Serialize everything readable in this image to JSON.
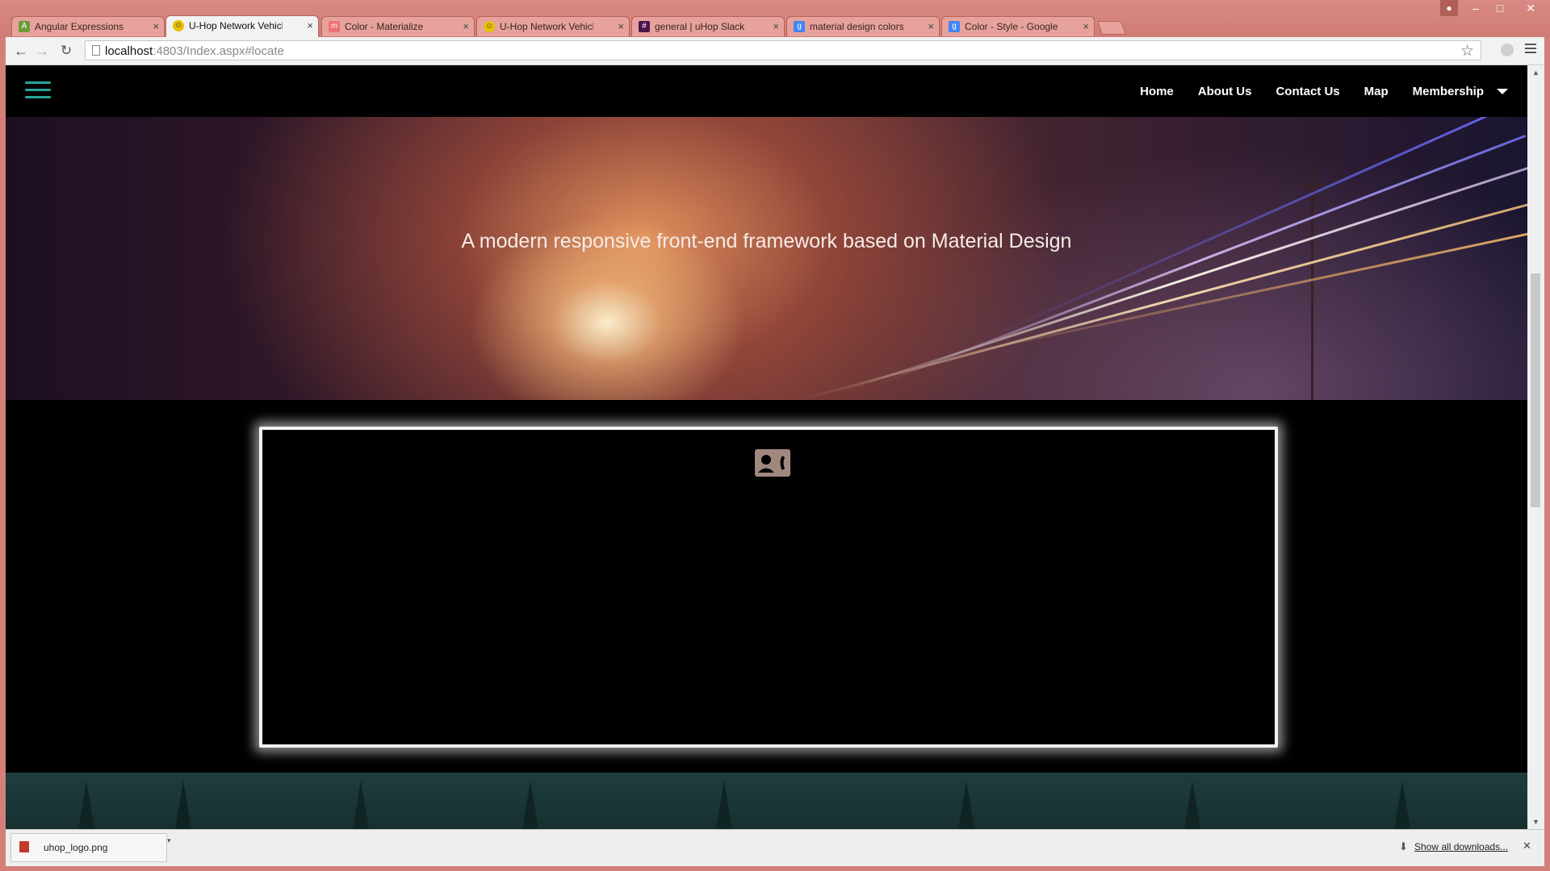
{
  "browser": {
    "tabs": [
      {
        "title": "Angular Expressions",
        "favicon": "angular-favicon",
        "color": "#6a9a3a",
        "active": false
      },
      {
        "title": "U-Hop Network Vehicle S",
        "favicon": "smiley-favicon",
        "color": "#e8c000",
        "active": true
      },
      {
        "title": "Color - Materialize",
        "favicon": "materialize-favicon",
        "color": "#ee6e73",
        "active": false
      },
      {
        "title": "U-Hop Network Vehicle S",
        "favicon": "smiley-favicon",
        "color": "#e8c000",
        "active": false
      },
      {
        "title": "general | uHop Slack",
        "favicon": "slack-favicon",
        "color": "#4a154b",
        "active": false
      },
      {
        "title": "material design colors - G",
        "favicon": "google-favicon",
        "color": "#4285f4",
        "active": false
      },
      {
        "title": "Color - Style - Google des",
        "favicon": "google-favicon",
        "color": "#4285f4",
        "active": false
      }
    ],
    "tab_close": "×",
    "url_host": "localhost",
    "url_rest": ":4803/Index.aspx#locate"
  },
  "site": {
    "nav": {
      "links": [
        "Home",
        "About Us",
        "Contact Us",
        "Map",
        "Membership"
      ],
      "accent": "#26a69a"
    },
    "hero": {
      "tagline": "A modern responsive front-end framework based on Material Design"
    },
    "card": {
      "icon": "contact-card-icon",
      "icon_color": "#a1887f"
    }
  },
  "downloads": {
    "file_name": "uhop_logo.png",
    "show_all": "Show all downloads..."
  }
}
